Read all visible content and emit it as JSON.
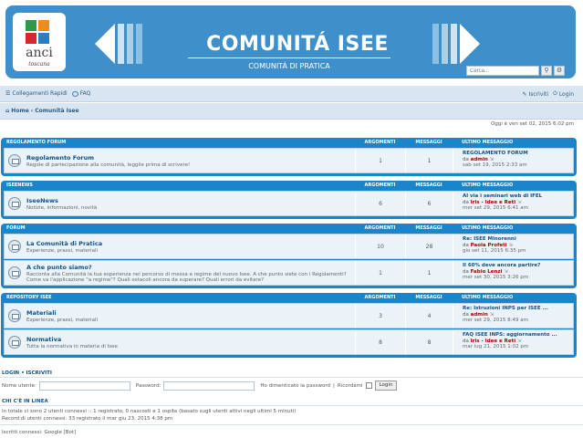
{
  "banner": {
    "logo_main": "anci",
    "logo_sub": "toscana",
    "title": "COMUNITÁ ISEE",
    "subtitle": "COMUNITÁ DI PRATICA",
    "search_placeholder": "Cerca...",
    "colors": {
      "banner": "#3f8fcb",
      "logo_green": "#2e9a47",
      "logo_orange": "#ef8a1f",
      "logo_red": "#d9262e",
      "logo_blue": "#2b7cc2"
    }
  },
  "nav": {
    "quick_links": "Collegamenti Rapidi",
    "faq": "FAQ",
    "register": "Iscriviti",
    "login": "Login",
    "breadcrumb_home": "Home",
    "breadcrumb_sep": "‹",
    "breadcrumb_current": "Comunità Isee",
    "date": "Oggi è ven set 02, 2015 6:02 pm"
  },
  "categories": [
    {
      "name": "REGOLAMENTO FORUM",
      "col_topics": "ARGOMENTI",
      "col_posts": "MESSAGGI",
      "col_last": "ULTIMO MESSAGGIO",
      "forums": [
        {
          "title": "Regolamento Forum",
          "desc": "Regole di partecipazione alla comunità, leggile prima di scrivere!",
          "topics": "1",
          "posts": "1",
          "last_title": "REGOLAMENTO FORUM",
          "last_by": "da",
          "last_user": "admin",
          "last_date": "sab set 19, 2015 2:33 am"
        }
      ]
    },
    {
      "name": "ISEENEWS",
      "col_topics": "ARGOMENTI",
      "col_posts": "MESSAGGI",
      "col_last": "ULTIMO MESSAGGIO",
      "forums": [
        {
          "title": "IseeNews",
          "desc": "Notizie, informazioni, novità",
          "topics": "6",
          "posts": "6",
          "last_title": "Al via i seminari web di IFEL",
          "last_by": "da",
          "last_user": "Iris - Idee e Reti",
          "last_date": "mer set 29, 2015 6:41 am"
        }
      ]
    },
    {
      "name": "FORUM",
      "col_topics": "ARGOMENTI",
      "col_posts": "MESSAGGI",
      "col_last": "ULTIMO MESSAGGIO",
      "forums": [
        {
          "title": "La Comunità di Pratica",
          "desc": "Esperienze, prassi, materiali",
          "topics": "10",
          "posts": "28",
          "last_title": "Re: ISEE Minorenni",
          "last_by": "da",
          "last_user": "Paola Profeti",
          "last_date": "gio set 11, 2015 6:35 pm"
        },
        {
          "title": "A che punto siamo?",
          "desc": "Racconta alla Comunità la tua esperienza nel percorso di messa a regime del nuovo Isee. A che punto siete con i Regolamenti? Come va l'applicazione \"a regime\"? Quali ostacoli ancora da superare? Quali errori da evitare?",
          "topics": "1",
          "posts": "1",
          "last_title": "Il 60% deve ancora partire?",
          "last_by": "da",
          "last_user": "Fabio Lenzi",
          "last_date": "mer set 30, 2015 3:26 pm"
        }
      ]
    },
    {
      "name": "REPOSITORY ISEE",
      "col_topics": "ARGOMENTI",
      "col_posts": "MESSAGGI",
      "col_last": "ULTIMO MESSAGGIO",
      "forums": [
        {
          "title": "Materiali",
          "desc": "Esperienze, prassi, materiali",
          "topics": "3",
          "posts": "4",
          "last_title": "Re: Istruzioni INPS per ISEE ...",
          "last_by": "da",
          "last_user": "admin",
          "last_date": "mer set 29, 2015 8:49 am"
        },
        {
          "title": "Normativa",
          "desc": "Tutta la normativa in materia di Isee",
          "topics": "8",
          "posts": "8",
          "last_title": "FAQ ISEE INPS: aggiornamento ...",
          "last_by": "da",
          "last_user": "Iris - Idee e Reti",
          "last_date": "mar lug 21, 2015 1:02 pm"
        }
      ]
    }
  ],
  "login": {
    "title": "LOGIN • ISCRIVITI",
    "username_label": "Nome utente:",
    "password_label": "Password:",
    "forgot": "Ho dimenticato la password",
    "remember": "Ricordami",
    "button": "Login"
  },
  "online": {
    "title": "CHI C'È IN LINEA",
    "line1": "In totale ci sono 2 utenti connessi :: 1 registrato, 0 nascosti e 1 ospite (basato sugli utenti attivi negli ultimi 5 minuti)",
    "line2": "Record di utenti connessi: 33 registrato il mar giu 23, 2015 4:38 pm",
    "line3": "Iscritti connessi: Google [Bot]"
  }
}
